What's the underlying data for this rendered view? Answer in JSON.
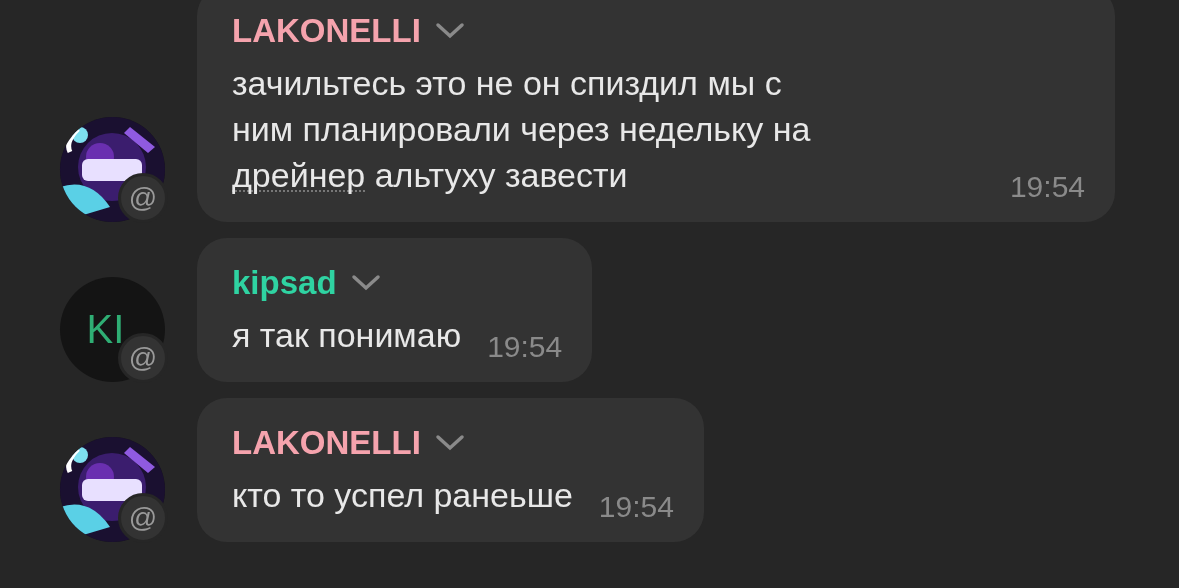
{
  "messages": [
    {
      "author": "LAKONELLI",
      "color": "#f5a3ad",
      "avatar": {
        "kind": "picture"
      },
      "badge": "@",
      "lines": [
        [
          {
            "text": "зачильтесь это не он спиздил мы с",
            "dotted": false
          }
        ],
        [
          {
            "text": "ним планировали через недельку на",
            "dotted": false
          }
        ],
        [
          {
            "text": "дрейнер",
            "dotted": true
          },
          {
            "text": " альтуху завести",
            "dotted": false
          }
        ]
      ],
      "time": "19:54"
    },
    {
      "author": "kipsad",
      "color": "#2fd3a2",
      "avatar": {
        "kind": "initials",
        "text": "KI"
      },
      "badge": "@",
      "lines": [
        [
          {
            "text": "я так понимаю",
            "dotted": false
          }
        ]
      ],
      "time": "19:54"
    },
    {
      "author": "LAKONELLI",
      "color": "#f5a3ad",
      "avatar": {
        "kind": "picture"
      },
      "badge": "@",
      "lines": [
        [
          {
            "text": "кто то успел ранеьше",
            "dotted": false
          }
        ]
      ],
      "time": "19:54"
    }
  ]
}
